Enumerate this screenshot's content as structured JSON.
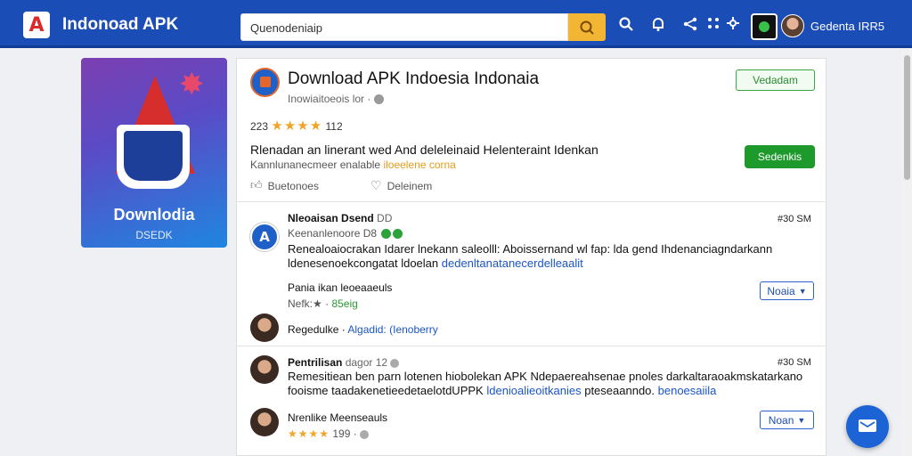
{
  "header": {
    "brand": "Indonoad APK",
    "search_value": "Quenodeniaip",
    "user_name": "Gedenta IRR5"
  },
  "sidebar": {
    "app_icon_title": "Downlodia",
    "app_icon_subtitle": "DSEDK"
  },
  "app": {
    "title": "Download APK Indoesia Indonaia",
    "developer": "Inowiaitoeois lor ·",
    "rating_prefix": "223",
    "rating_stars": "★★★★",
    "rating_suffix": "112",
    "description_line1": "Rlenadan an linerant wed And deleleinaid Helenteraint Idenkan",
    "description_line2_a": "Kannlunanecmeer enalable",
    "description_line2_b": "iloeelene corna",
    "like_label": "Buetonoes",
    "save_label": "Deleinem",
    "outline_button": "Vedadam",
    "green_button": "Sedenkis"
  },
  "comments": [
    {
      "name": "Nleoaisan Dsend",
      "name_meta": "DD",
      "time": "#30 SM",
      "sub": "Keenanlenoore D8",
      "body_line1": "Renealoaiocrakan Idarer lnekann saleolll:  Aboissernand wl fap: lda gend Ihdenanciagndarkann",
      "body_line2_plain": "ldenesenoekcongatat  ldoelan",
      "body_line2_link": "dedenltanatanecerdelleaalit",
      "reply_name": "Pania ikan leoeaaeuls",
      "reply_meta": "Nefk:★ · ",
      "reply_meta_green": "85eig",
      "select_label": "Noaia",
      "footer_name": "Regedulke",
      "footer_link1": "Algadid:",
      "footer_link2": "(Ienoberry"
    },
    {
      "name": "Pentrilisan",
      "name_meta": "dagor 12",
      "time": "#30 SM",
      "body_line1": "Remesitiean ben parn lotenen hiobolekan APK  Ndepaereahsenae pnoles darkaltaraoakmskatarkano",
      "body_line2_plain": "fooisme taadakenetieedetaelotdUPPK",
      "body_line2_link": "ldenioalieoitkanies",
      "body_line2_tail": "pteseaanndo.",
      "body_line2_link2": "benoesaiila",
      "reply_name": "Nrenlike Meenseauls",
      "reply_stars": "★★★★",
      "reply_meta": "199 ·",
      "select_label": "Noan"
    }
  ]
}
